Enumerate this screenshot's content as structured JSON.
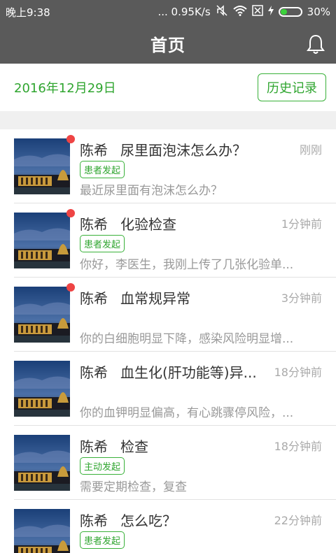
{
  "status": {
    "time": "晚上9:38",
    "net": "... 0.95K/s",
    "battery": "30%"
  },
  "header": {
    "title": "首页"
  },
  "datebar": {
    "date": "2016年12月29日",
    "history_label": "历史记录"
  },
  "conversations": [
    {
      "name": "陈希",
      "subject": "尿里面泡沫怎么办？",
      "time": "刚刚",
      "badge": "患者发起",
      "preview": "最近尿里面有泡沫怎么办？",
      "unread": true
    },
    {
      "name": "陈希",
      "subject": "化验检查",
      "time": "1分钟前",
      "badge": "患者发起",
      "preview": "你好，李医生，我刚上传了几张化验单...",
      "unread": true
    },
    {
      "name": "陈希",
      "subject": "血常规异常",
      "time": "3分钟前",
      "badge": "",
      "preview": "你的白细胞明显下降，感染风险明显增...",
      "unread": true
    },
    {
      "name": "陈希",
      "subject": "血生化(肝功能等)异...",
      "time": "18分钟前",
      "badge": "",
      "preview": "你的血钾明显偏高，有心跳骤停风险，...",
      "unread": false
    },
    {
      "name": "陈希",
      "subject": "检查",
      "time": "18分钟前",
      "badge": "主动发起",
      "preview": "需要定期检查，复查",
      "unread": false
    },
    {
      "name": "陈希",
      "subject": "怎么吃？",
      "time": "22分钟前",
      "badge": "患者发起",
      "preview": "",
      "unread": false
    }
  ]
}
